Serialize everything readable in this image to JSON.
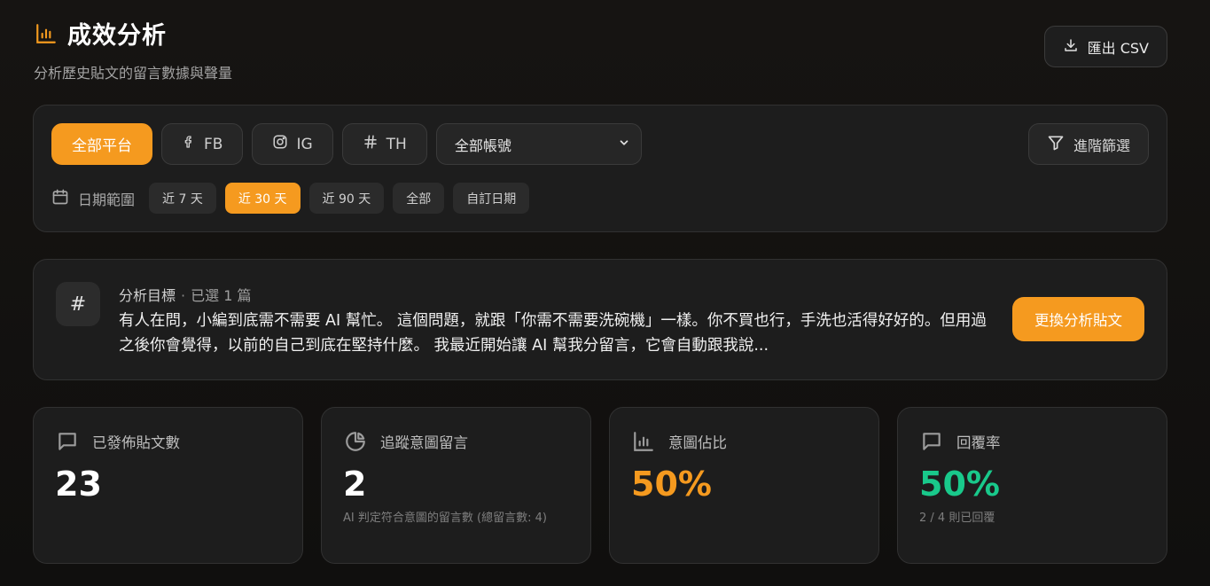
{
  "header": {
    "title": "成效分析",
    "subtitle": "分析歷史貼文的留言數據與聲量",
    "title_icon": "bar-chart-icon",
    "export_label": "匯出 CSV",
    "export_icon": "download-icon"
  },
  "filters": {
    "platforms": [
      {
        "label": "全部平台",
        "icon": "",
        "active": true
      },
      {
        "label": "FB",
        "icon": "facebook-icon",
        "active": false
      },
      {
        "label": "IG",
        "icon": "instagram-icon",
        "active": false
      },
      {
        "label": "TH",
        "icon": "hash-icon",
        "active": false
      }
    ],
    "account_select": {
      "value": "全部帳號"
    },
    "advanced_label": "進階篩選",
    "date_label": "日期範圍",
    "date_ranges": [
      {
        "label": "近 7 天",
        "active": false
      },
      {
        "label": "近 30 天",
        "active": true
      },
      {
        "label": "近 90 天",
        "active": false
      },
      {
        "label": "全部",
        "active": false
      },
      {
        "label": "自訂日期",
        "active": false
      }
    ]
  },
  "target": {
    "label": "分析目標",
    "selected_count": "已選 1 篇",
    "text": "有人在問，小編到底需不需要 AI 幫忙。 這個問題，就跟「你需不需要洗碗機」一樣。你不買也行，手洗也活得好好的。但用過之後你會覺得，以前的自己到底在堅持什麼。 我最近開始讓 AI 幫我分留言，它會自動跟我說...",
    "change_button": "更換分析貼文"
  },
  "stats": [
    {
      "label": "已發佈貼文數",
      "value": "23",
      "note": "",
      "icon": "message-icon",
      "accent": "#ffffff"
    },
    {
      "label": "追蹤意圖留言",
      "value": "2",
      "note": "AI 判定符合意圖的留言數 (總留言數: 4)",
      "icon": "pie-chart-icon",
      "accent": "#ffffff"
    },
    {
      "label": "意圖佔比",
      "value": "50%",
      "note": "",
      "icon": "bar-chart-icon",
      "accent": "#f59a1f"
    },
    {
      "label": "回覆率",
      "value": "50%",
      "note": "2 / 4 則已回覆",
      "icon": "message-icon",
      "accent": "#19c98b"
    }
  ],
  "colors": {
    "accent": "#f59a1f",
    "success": "#19c98b",
    "background": "#141312"
  }
}
